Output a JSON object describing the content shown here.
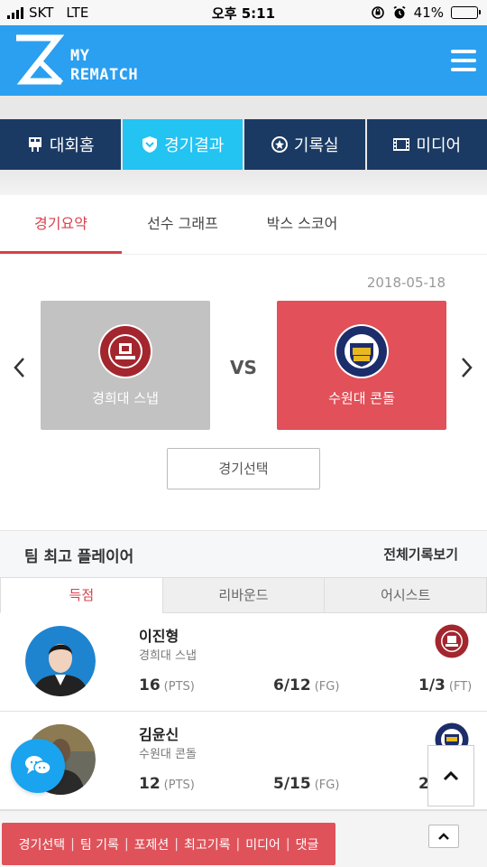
{
  "status_bar": {
    "carrier": "SKT",
    "network": "LTE",
    "time": "오후 5:11",
    "battery": "41%",
    "battery_level": 0.41
  },
  "header": {
    "logo_line1": "MY",
    "logo_line2": "REMATCH"
  },
  "main_nav": [
    {
      "label": "대회홈",
      "icon": "scoreboard-icon"
    },
    {
      "label": "경기결과",
      "icon": "shield-icon",
      "active": true
    },
    {
      "label": "기록실",
      "icon": "medal-icon"
    },
    {
      "label": "미디어",
      "icon": "film-icon"
    }
  ],
  "sub_tabs": [
    {
      "label": "경기요약",
      "active": true
    },
    {
      "label": "선수 그래프"
    },
    {
      "label": "박스 스코어"
    }
  ],
  "match": {
    "date": "2018-05-18",
    "home_team": "경희대 스냅",
    "away_team": "수원대 콘돌",
    "vs": "VS",
    "select_label": "경기선택"
  },
  "top_players": {
    "title": "팀 최고 플레이어",
    "more_label": "전체기록보기",
    "tabs": [
      {
        "label": "득점",
        "active": true
      },
      {
        "label": "리바운드"
      },
      {
        "label": "어시스트"
      }
    ],
    "players": [
      {
        "name": "이진형",
        "team": "경희대 스냅",
        "pts": "16",
        "pts_unit": "(PTS)",
        "fg": "6/12",
        "fg_unit": "(FG)",
        "ft": "1/3",
        "ft_unit": "(FT)"
      },
      {
        "name": "김윤신",
        "team": "수원대 콘돌",
        "pts": "12",
        "pts_unit": "(PTS)",
        "fg": "5/15",
        "fg_unit": "(FG)",
        "ft": "2/",
        "ft_unit": ""
      }
    ]
  },
  "bottom_bar": {
    "links": [
      "경기선택",
      "팀 기록",
      "포제션",
      "최고기록",
      "미디어",
      "댓글"
    ]
  },
  "colors": {
    "header": "#2b9ff0",
    "nav": "#1b3a63",
    "nav_active": "#23c3f2",
    "accent": "#d8414b",
    "away_team": "#e25059",
    "home_team": "#c2c2c2"
  }
}
